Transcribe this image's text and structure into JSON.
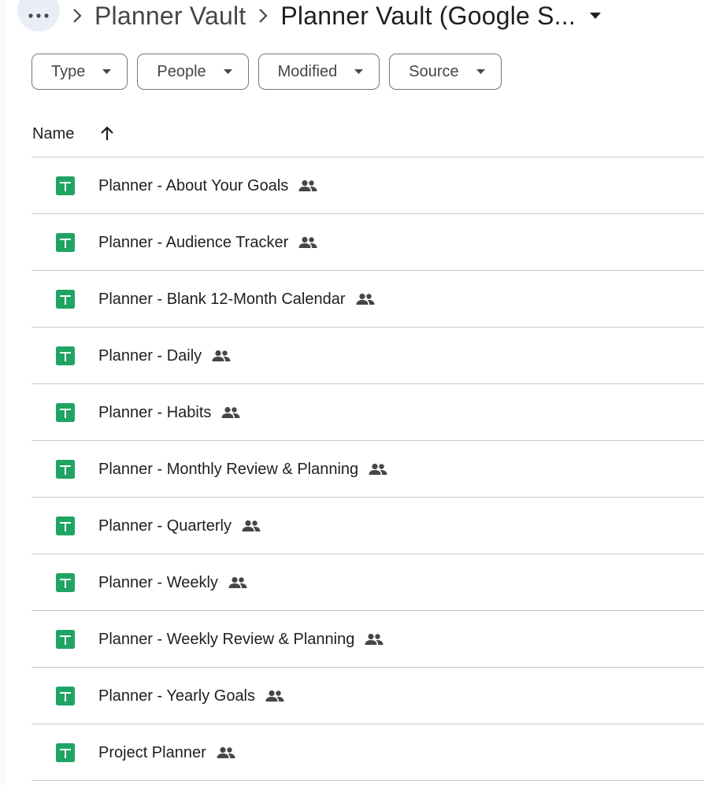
{
  "breadcrumb": {
    "parent": "Planner Vault",
    "current": "Planner Vault (Google S..."
  },
  "filters": [
    {
      "label": "Type"
    },
    {
      "label": "People"
    },
    {
      "label": "Modified"
    },
    {
      "label": "Source"
    }
  ],
  "list_header": {
    "name_label": "Name"
  },
  "files": [
    {
      "name": "Planner - About Your Goals",
      "icon": "google-sheets-icon",
      "shared": true
    },
    {
      "name": "Planner - Audience Tracker",
      "icon": "google-sheets-icon",
      "shared": true
    },
    {
      "name": "Planner - Blank 12-Month Calendar",
      "icon": "google-sheets-icon",
      "shared": true
    },
    {
      "name": "Planner - Daily",
      "icon": "google-sheets-icon",
      "shared": true
    },
    {
      "name": "Planner - Habits",
      "icon": "google-sheets-icon",
      "shared": true
    },
    {
      "name": "Planner - Monthly Review & Planning",
      "icon": "google-sheets-icon",
      "shared": true
    },
    {
      "name": "Planner - Quarterly",
      "icon": "google-sheets-icon",
      "shared": true
    },
    {
      "name": "Planner - Weekly",
      "icon": "google-sheets-icon",
      "shared": true
    },
    {
      "name": "Planner - Weekly Review & Planning",
      "icon": "google-sheets-icon",
      "shared": true
    },
    {
      "name": "Planner - Yearly Goals",
      "icon": "google-sheets-icon",
      "shared": true
    },
    {
      "name": "Project Planner",
      "icon": "google-sheets-icon",
      "shared": true
    }
  ],
  "colors": {
    "sheets_green": "#1fa463",
    "chip_border": "#747775",
    "divider": "#c7c7c7",
    "more_button_bg": "#e9eef6"
  }
}
